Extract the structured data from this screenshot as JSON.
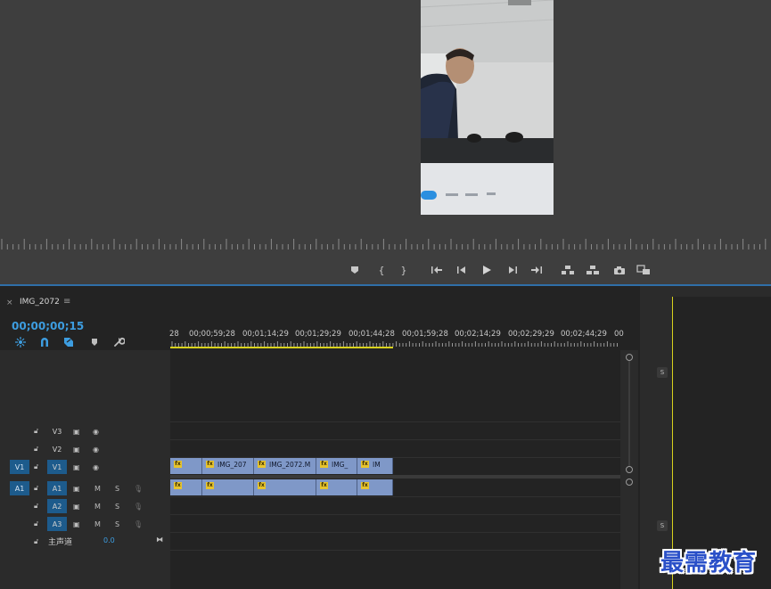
{
  "program_monitor": {
    "transport_buttons": [
      "marker",
      "mark-in",
      "mark-out",
      "go-to-in",
      "step-back",
      "play",
      "step-forward",
      "go-to-out",
      "lift",
      "extract",
      "export-frame",
      "compare"
    ]
  },
  "timeline": {
    "sequence_tab": "IMG_2072",
    "close_glyph": "×",
    "menu_glyph": "≡",
    "playhead_timecode": "00;00;00;15",
    "ruler_timecodes": [
      "28",
      "00;00;59;28",
      "00;01;14;29",
      "00;01;29;29",
      "00;01;44;28",
      "00;01;59;28",
      "00;02;14;29",
      "00;02;29;29",
      "00;02;44;29",
      "00"
    ],
    "video_tracks": [
      {
        "name": "V3",
        "source": ""
      },
      {
        "name": "V2",
        "source": ""
      },
      {
        "name": "V1",
        "source": "V1"
      }
    ],
    "audio_tracks": [
      {
        "name": "A1",
        "source": "A1",
        "mute": "M",
        "solo": "S"
      },
      {
        "name": "A2",
        "source": "",
        "mute": "M",
        "solo": "S"
      },
      {
        "name": "A3",
        "source": "",
        "mute": "M",
        "solo": "S"
      }
    ],
    "master_track": {
      "name": "主声道",
      "volume": "0.0"
    },
    "video_clips": [
      {
        "label": ""
      },
      {
        "label": "IMG_207"
      },
      {
        "label": "IMG_2072.M"
      },
      {
        "label": "IMG_"
      },
      {
        "label": "IM"
      }
    ],
    "fx_badge": "fx",
    "right_solo_labels": [
      "S",
      "S"
    ]
  },
  "watermark": "最需教育",
  "colors": {
    "accent_blue": "#3d9de0",
    "track_target": "#1d5b8c",
    "clip": "#7f98c8",
    "fx_badge": "#e7c42d",
    "work_area": "#d8d21d"
  }
}
